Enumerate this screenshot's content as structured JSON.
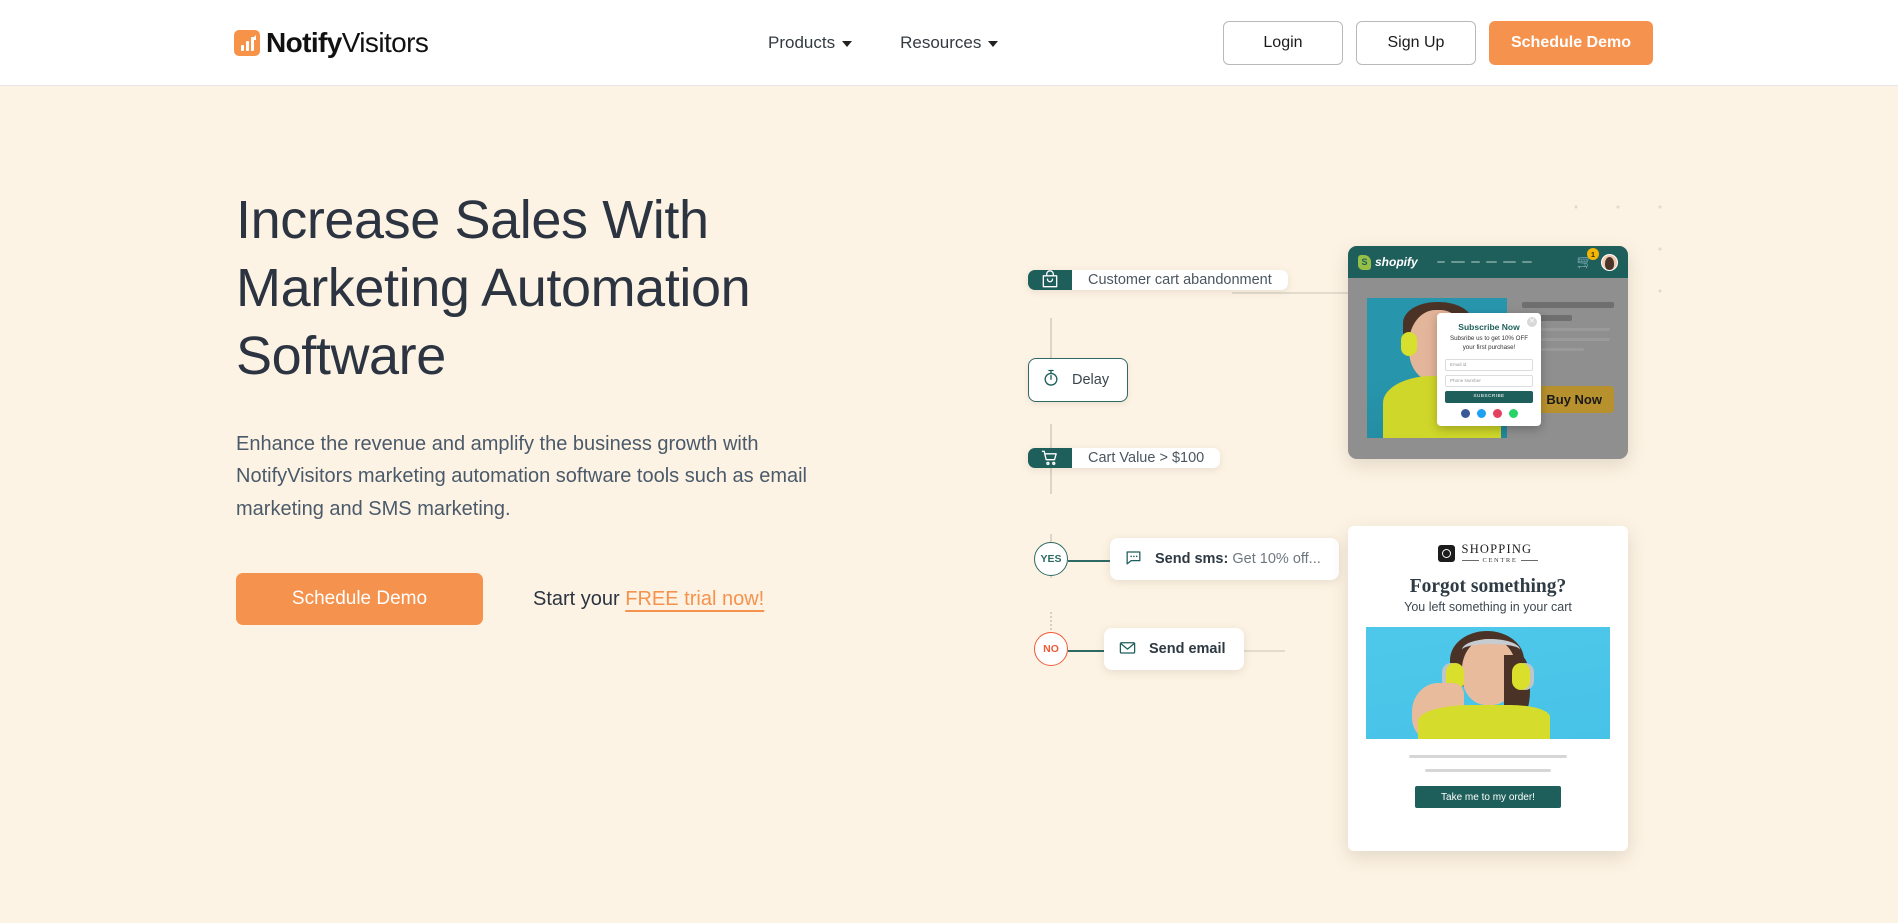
{
  "header": {
    "logo": {
      "bold": "Notify",
      "normal": "Visitors",
      "icon": "chart-logo-icon"
    },
    "nav": [
      {
        "label": "Products",
        "icon": "chevron-down-icon"
      },
      {
        "label": "Resources",
        "icon": "chevron-down-icon"
      }
    ],
    "actions": {
      "login": "Login",
      "signup": "Sign Up",
      "demo": "Schedule Demo"
    }
  },
  "hero": {
    "headline": "Increase Sales With Marketing Automation Software",
    "subcopy": "Enhance the revenue and amplify the business growth with NotifyVisitors marketing automation software tools such as email marketing and SMS marketing.",
    "cta_primary": "Schedule Demo",
    "cta_text_prefix": "Start your ",
    "cta_link": "FREE trial now!"
  },
  "flow": {
    "nodes": [
      {
        "label": "Customer cart abandonment",
        "icon": "shopping-bag-icon"
      },
      {
        "label": "Delay",
        "icon": "stopwatch-icon"
      },
      {
        "label": "Cart Value > $100",
        "icon": "shopping-cart-icon"
      },
      {
        "label_bold": "Send sms:",
        "label_rest": " Get 10% off...",
        "icon": "chat-bubble-icon"
      },
      {
        "label_bold": "Send email",
        "icon": "envelope-icon"
      }
    ],
    "branches": {
      "yes": "YES",
      "no": "NO"
    }
  },
  "shopify_mock": {
    "brand": "shopify",
    "cart_count": "1",
    "buy_now": "Buy Now",
    "popup": {
      "title": "Subscribe Now",
      "subtitle": "Subsribe us to get 10% OFF your first purchase!",
      "email_placeholder": "Email id",
      "phone_placeholder": "Phone Number",
      "button": "SUBSCRIBE",
      "social": [
        "facebook-icon",
        "twitter-icon",
        "instagram-icon",
        "whatsapp-icon"
      ]
    }
  },
  "email_mock": {
    "brand_name": "SHOPPING",
    "brand_sub": "CENTRE",
    "title": "Forgot something?",
    "subtitle": "You left something in your cart",
    "button": "Take me to my order!"
  },
  "colors": {
    "background": "#FDF3E4",
    "accent_orange": "#F5934E",
    "teal": "#1F5F5B",
    "headline": "#2B3440",
    "no_badge": "#F15A36"
  }
}
